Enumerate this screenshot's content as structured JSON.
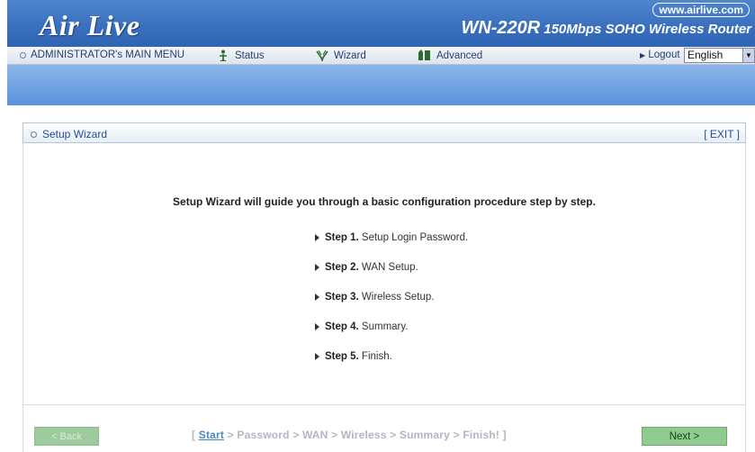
{
  "header": {
    "logo": "Air Live",
    "url": "www.airlive.com",
    "model": "WN-220R",
    "tagline": "150Mbps SOHO Wireless Router"
  },
  "menu": {
    "main": "ADMINISTRATOR's MAIN MENU",
    "status": "Status",
    "wizard": "Wizard",
    "advanced": "Advanced",
    "logout": "Logout",
    "language": "English"
  },
  "panel": {
    "title": "Setup Wizard",
    "exit": "[ EXIT ]",
    "intro": "Setup Wizard will guide you through a basic configuration procedure step by step.",
    "steps": [
      {
        "label": "Step 1.",
        "text": "Setup Login Password."
      },
      {
        "label": "Step 2.",
        "text": "WAN Setup."
      },
      {
        "label": "Step 3.",
        "text": "Wireless Setup."
      },
      {
        "label": "Step 4.",
        "text": "Summary."
      },
      {
        "label": "Step 5.",
        "text": "Finish."
      }
    ]
  },
  "footer": {
    "back": "< Back",
    "next": "Next >",
    "crumb_open": "[",
    "crumb_current": "Start",
    "crumb_rest": "> Password > WAN > Wireless > Summary > Finish! ]"
  },
  "colors": {
    "header_blue": "#3a70bf",
    "band_blue": "#6fa2e0",
    "title_text": "#1f4f96",
    "button_green": "#8fca8f"
  }
}
